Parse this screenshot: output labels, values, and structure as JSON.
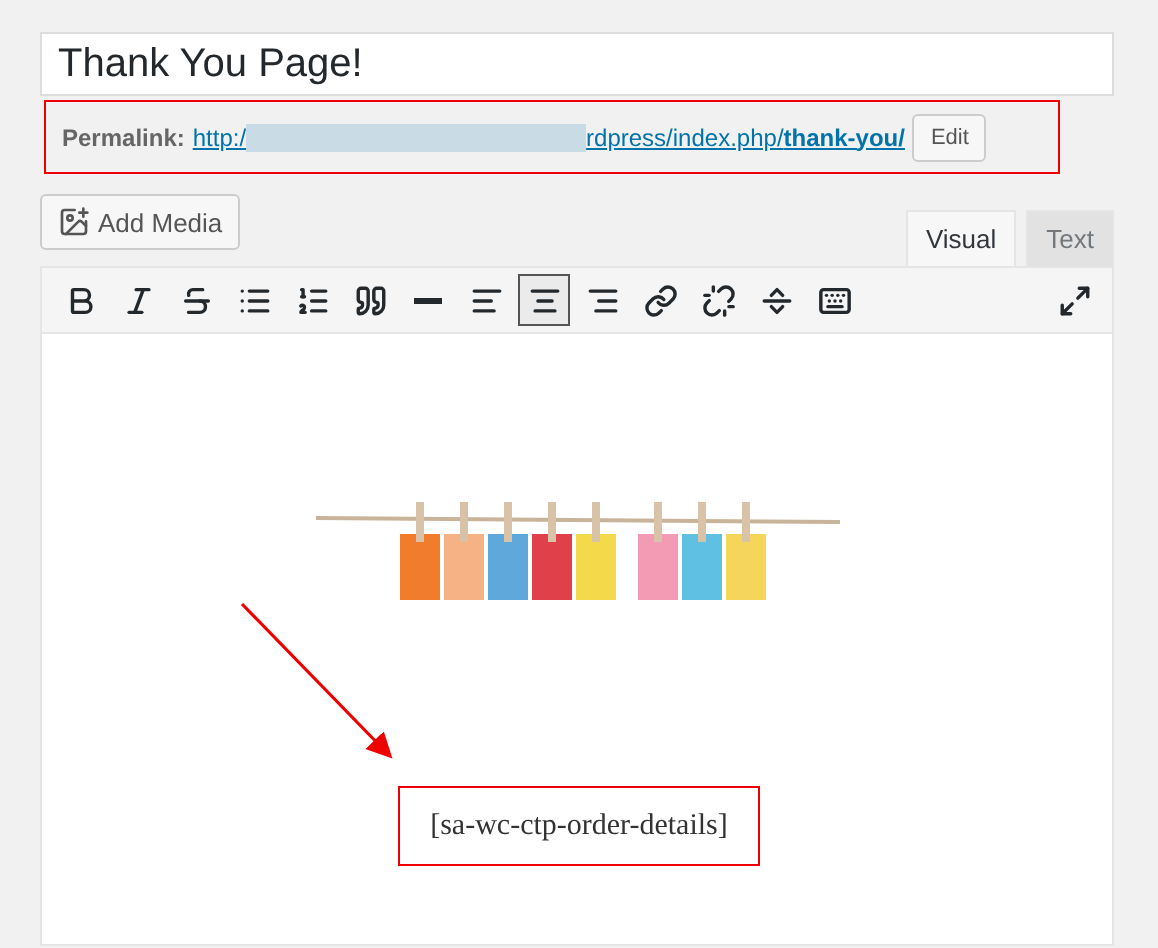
{
  "title": {
    "value": "Thank You Page!"
  },
  "permalink": {
    "label": "Permalink:",
    "url_start": "http:/",
    "url_end": "rdpress/index.php/**thank-you/**",
    "edit_button": "Edit"
  },
  "add_media": "Add Media",
  "tabs": [
    {
      "label": "Visual",
      "selected": true
    },
    {
      "label": "Text",
      "selected": false
    }
  ],
  "toolbar": [
    {
      "kind": "bold",
      "selected": false
    },
    {
      "kind": "italic",
      "selected": false
    },
    {
      "kind": "strike",
      "selected": false
    },
    {
      "kind": "bullets",
      "selected": false
    },
    {
      "kind": "numbers",
      "selected": false
    },
    {
      "kind": "quote",
      "selected": false
    },
    {
      "kind": "rule",
      "selected": false
    },
    {
      "kind": "align-left",
      "selected": false
    },
    {
      "kind": "align-center",
      "selected": true
    },
    {
      "kind": "align-right",
      "selected": false
    },
    {
      "kind": "link",
      "selected": false
    },
    {
      "kind": "unlink",
      "selected": false
    },
    {
      "kind": "more",
      "selected": false
    },
    {
      "kind": "kitchen",
      "selected": false
    }
  ],
  "content": {
    "shortcode": "[sa-wc-ctp-order-details]"
  }
}
